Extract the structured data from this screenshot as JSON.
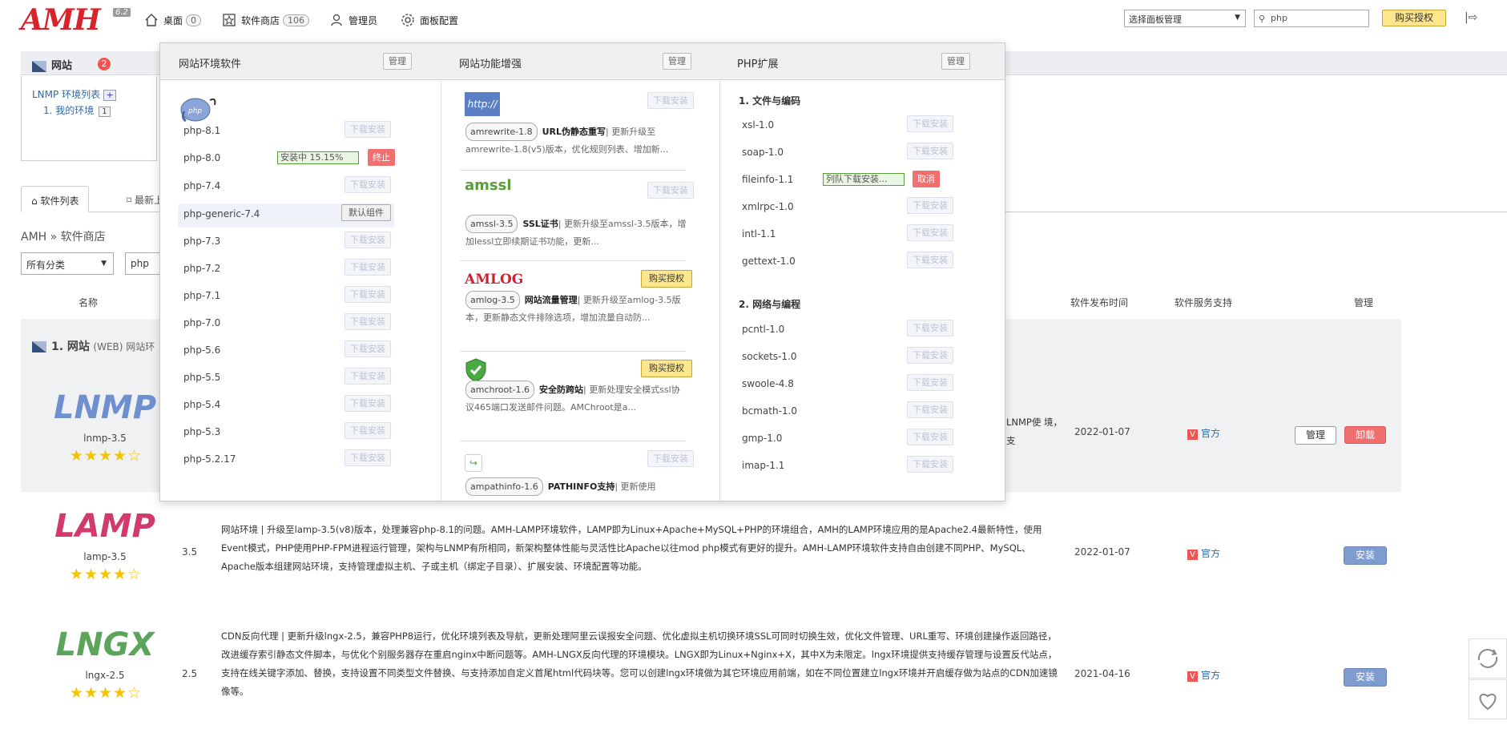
{
  "topbar": {
    "logo": "AMH",
    "version": "6.2",
    "nav": [
      {
        "label": "桌面",
        "count": "0"
      },
      {
        "label": "软件商店",
        "count": "106"
      },
      {
        "label": "管理员"
      },
      {
        "label": "面板配置"
      }
    ],
    "panel_select": "选择面板管理",
    "search_value": "php",
    "buy_label": "购买授权"
  },
  "website": {
    "label": "网站",
    "badge": "2",
    "lnmp_list": "LNMP 环境列表",
    "env_item": "1. 我的环境",
    "env_count": "1"
  },
  "tabs": {
    "soft_list": "软件列表",
    "latest": "最新上架"
  },
  "breadcrumb": "AMH » 软件商店",
  "filter": {
    "category": "所有分类",
    "keyword": "php"
  },
  "table": {
    "headers": {
      "name": "名称",
      "date": "软件发布时间",
      "support": "软件服务支持",
      "manage": "管理"
    },
    "category": {
      "prefix": "1. 网站",
      "suffix": "(WEB) 网站环"
    },
    "rows": [
      {
        "logo": "LNMP",
        "pkg": "lnmp-3.5",
        "stars": "★★★★☆",
        "ver": "",
        "desc": "LNMP使 境，支",
        "date": "2022-01-07",
        "support": "官方",
        "manage": "管理",
        "uninstall": "卸载"
      },
      {
        "logo": "LAMP",
        "pkg": "lamp-3.5",
        "stars": "★★★★☆",
        "ver": "3.5",
        "desc": "网站环境 | 升级至lamp-3.5(v8)版本，处理兼容php-8.1的问题。AMH-LAMP环境软件，LAMP即为Linux+Apache+MySQL+PHP的环境组合，AMH的LAMP环境应用的是Apache2.4最新特性，使用Event模式，PHP使用PHP-FPM进程运行管理，架构与LNMP有所相同，新架构整体性能与灵活性比Apache以往mod php模式有更好的提升。AMH-LAMP环境软件支持自由创建不同PHP、MySQL、Apache版本组建网站环境，支持管理虚拟主机、子或主机（绑定子目录）、扩展安装、环境配置等功能。",
        "date": "2022-01-07",
        "support": "官方",
        "install": "安装"
      },
      {
        "logo": "LNGX",
        "pkg": "lngx-2.5",
        "stars": "★★★★☆",
        "ver": "2.5",
        "desc": "CDN反向代理 | 更新升级lngx-2.5，兼容PHP8运行，优化环境列表及导航，更新处理阿里云误报安全问题、优化虚拟主机切换环境SSL可同时切换生效，优化文件管理、URL重写、环境创建操作返回路径，改进缓存索引静态文件脚本，与优化个别服务器存在重启nginx中断问题等。AMH-LNGX反向代理的环境模块。LNGX即为Linux+Nginx+X，其中X为未限定。lngx环境提供支持缓存管理与设置反代站点，支持在线关键字添加、替换，支持设置不同类型文件替换、与支持添加自定义首尾html代码块等。您可以创建lngx环境做为其它环境应用前端，如在不同位置建立lngx环境并开启缓存做为站点的CDN加速镜像等。",
        "date": "2021-04-16",
        "support": "官方",
        "install": "安装"
      }
    ]
  },
  "dropdown": {
    "col1": {
      "title": "网站环境软件",
      "manage": "管理",
      "items": [
        {
          "name": "php-8.1",
          "action": "下载安装"
        },
        {
          "name": "php-8.0",
          "progress": "安装中 15.15%",
          "stop": "终止"
        },
        {
          "name": "php-7.4",
          "action": "下载安装"
        },
        {
          "name": "php-generic-7.4",
          "default": "默认组件"
        },
        {
          "name": "php-7.3",
          "action": "下载安装"
        },
        {
          "name": "php-7.2",
          "action": "下载安装"
        },
        {
          "name": "php-7.1",
          "action": "下载安装"
        },
        {
          "name": "php-7.0",
          "action": "下载安装"
        },
        {
          "name": "php-5.6",
          "action": "下载安装"
        },
        {
          "name": "php-5.5",
          "action": "下载安装"
        },
        {
          "name": "php-5.4",
          "action": "下载安装"
        },
        {
          "name": "php-5.3",
          "action": "下载安装"
        },
        {
          "name": "php-5.2.17",
          "action": "下载安装"
        }
      ]
    },
    "col2": {
      "title": "网站功能增强",
      "manage": "管理",
      "cards": [
        {
          "icon": "http://",
          "pill": "amrewrite-1.8",
          "name": "URL伪静态重写",
          "text": "| 更新升级至amrewrite-1.8(v5)版本，优化规则列表、增加新...",
          "action": "下载安装"
        },
        {
          "icon": "amssl",
          "pill": "amssl-3.5",
          "name": "SSL证书",
          "text": "| 更新升级至amssl-3.5版本，增加lessl立即续期证书功能，更新...",
          "action": "下载安装"
        },
        {
          "icon": "AMLOG",
          "pill": "amlog-3.5",
          "name": "网站流量管理",
          "text": "| 更新升级至amlog-3.5版本，更新静态文件排除选项，增加流量自动防...",
          "buy": "购买授权"
        },
        {
          "icon": "shield",
          "pill": "amchroot-1.6",
          "name": "安全防跨站",
          "text": "| 更新处理安全模式ssl协议465端口发送邮件问题。AMChroot是a...",
          "buy": "购买授权"
        },
        {
          "icon": "path",
          "pill": "ampathinfo-1.6",
          "name": "PATHINFO支持",
          "text": "| 更新使用",
          "action": "下载安装"
        }
      ]
    },
    "col3": {
      "title": "PHP扩展",
      "manage": "管理",
      "sections": [
        {
          "title": "1. 文件与编码",
          "items": [
            {
              "name": "xsl-1.0",
              "action": "下载安装"
            },
            {
              "name": "soap-1.0",
              "action": "下载安装"
            },
            {
              "name": "fileinfo-1.1",
              "progress": "列队下载安装...",
              "cancel": "取消"
            },
            {
              "name": "xmlrpc-1.0",
              "action": "下载安装"
            },
            {
              "name": "intl-1.1",
              "action": "下载安装"
            },
            {
              "name": "gettext-1.0",
              "action": "下载安装"
            }
          ]
        },
        {
          "title": "2. 网络与编程",
          "items": [
            {
              "name": "pcntl-1.0",
              "action": "下载安装"
            },
            {
              "name": "sockets-1.0",
              "action": "下载安装"
            },
            {
              "name": "swoole-4.8",
              "action": "下载安装"
            },
            {
              "name": "bcmath-1.0",
              "action": "下载安装"
            },
            {
              "name": "gmp-1.0",
              "action": "下载安装"
            },
            {
              "name": "imap-1.1",
              "action": "下载安装"
            }
          ]
        }
      ]
    }
  }
}
